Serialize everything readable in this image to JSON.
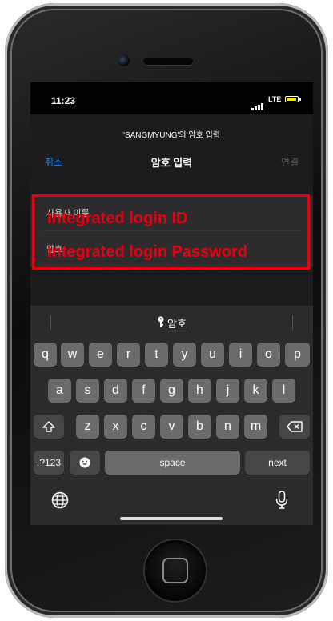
{
  "status": {
    "time": "11:23",
    "network": "LTE"
  },
  "dialog": {
    "subtitle": "'SANGMYUNG'의 암호 입력",
    "cancel_label": "취소",
    "title": "암호 입력",
    "connect_label": "연결"
  },
  "form": {
    "username_label": "사용자 이름",
    "password_label": "암호"
  },
  "annotation": {
    "line1": "Integrated login ID",
    "line2": "Integrated login Password",
    "color": "#e60012"
  },
  "keyboard": {
    "suggestion": "암호",
    "row1": [
      "q",
      "w",
      "e",
      "r",
      "t",
      "y",
      "u",
      "i",
      "o",
      "p"
    ],
    "row2": [
      "a",
      "s",
      "d",
      "f",
      "g",
      "h",
      "j",
      "k",
      "l"
    ],
    "row3": [
      "z",
      "x",
      "c",
      "v",
      "b",
      "n",
      "m"
    ],
    "numbers_label": ".?123",
    "space_label": "space",
    "next_label": "next"
  },
  "icons": {
    "shift": "shift-icon",
    "backspace": "backspace-icon",
    "emoji": "emoji-icon",
    "globe": "globe-icon",
    "microphone": "microphone-icon",
    "key": "key-icon"
  }
}
